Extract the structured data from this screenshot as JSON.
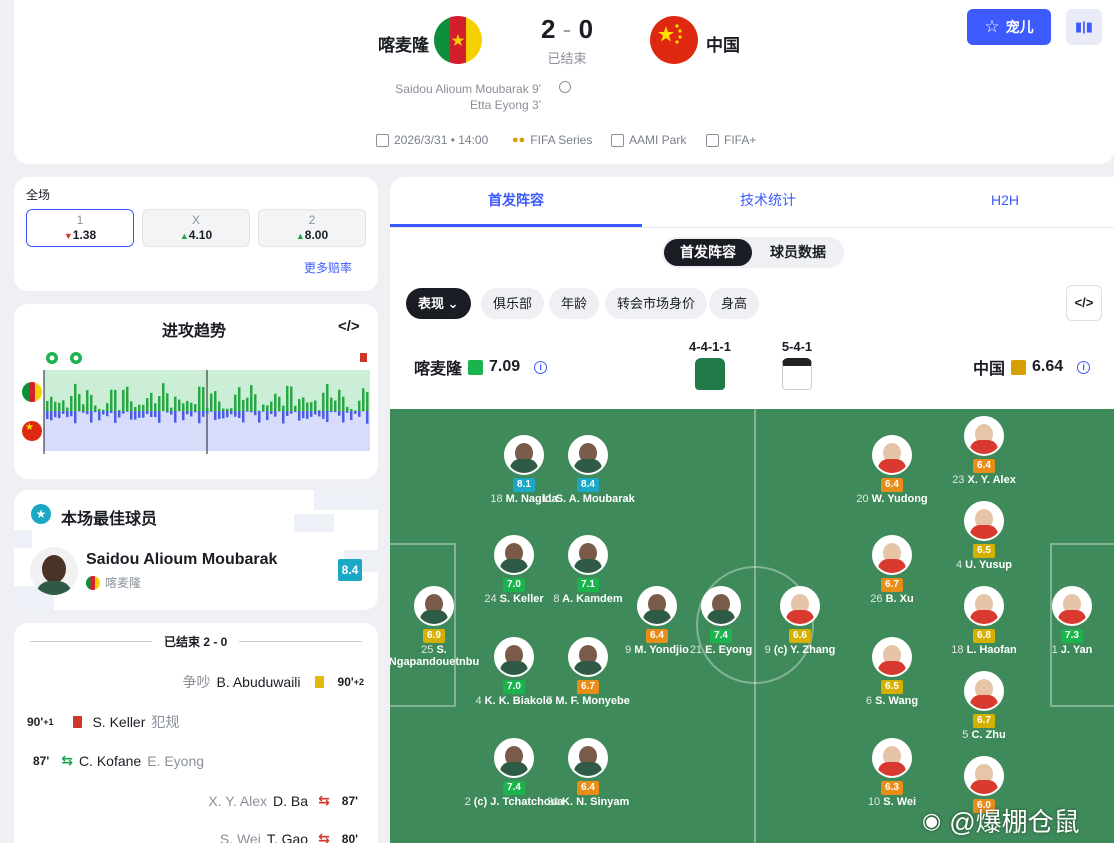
{
  "match": {
    "home_team": "喀麦隆",
    "away_team": "中国",
    "score_home": "2",
    "score_sep": "-",
    "score_away": "0",
    "status": "已结束",
    "scorers": [
      "Saidou Alioum Moubarak 9'",
      "Etta Eyong 3'"
    ],
    "date": "2026/3/31 • 14:00",
    "competition": "FIFA Series",
    "venue": "AAMI Park",
    "broadcast": "FIFA+",
    "follow_label": "宠儿"
  },
  "odds": {
    "title": "全场",
    "items": [
      {
        "label": "1",
        "value": "1.38",
        "trend": "down"
      },
      {
        "label": "X",
        "value": "4.10",
        "trend": "up"
      },
      {
        "label": "2",
        "value": "8.00",
        "trend": "up"
      }
    ],
    "more_label": "更多赔率"
  },
  "momentum": {
    "title": "进攻趋势",
    "embed": "</>"
  },
  "best_player": {
    "title": "本场最佳球员",
    "name": "Saidou Alioum Moubarak",
    "team": "喀麦隆",
    "rating": "8.4"
  },
  "events": {
    "header": "已结束 2 - 0",
    "items": [
      {
        "side": "right",
        "minute": "90'",
        "extra": "+2",
        "type": "yellow",
        "player": "B. Abuduwaili",
        "note": "争吵"
      },
      {
        "side": "left",
        "minute": "90'",
        "extra": "+1",
        "type": "red",
        "player": "S. Keller",
        "note": "犯规"
      },
      {
        "side": "left",
        "minute": "87'",
        "extra": "",
        "type": "sub",
        "player": "C. Kofane",
        "note": "E. Eyong"
      },
      {
        "side": "right",
        "minute": "87'",
        "extra": "",
        "type": "sub",
        "player": "D. Ba",
        "note": "X. Y. Alex"
      },
      {
        "side": "right",
        "minute": "80'",
        "extra": "",
        "type": "sub",
        "player": "T. Gao",
        "note": "S. Wei"
      }
    ]
  },
  "lineup": {
    "tabs": [
      "首发阵容",
      "技术统计",
      "H2H"
    ],
    "segments": [
      "首发阵容",
      "球员数据"
    ],
    "filters": [
      "表现",
      "俱乐部",
      "年龄",
      "转会市场身价",
      "身高"
    ],
    "home": {
      "name": "喀麦隆",
      "rating": "7.09",
      "formation": "4-4-1-1",
      "color": "#1bb34d"
    },
    "away": {
      "name": "中国",
      "rating": "6.64",
      "formation": "5-4-1",
      "color": "#d6a000"
    },
    "home_players": [
      {
        "no": "25",
        "name": "S. Ngapandouetnbu",
        "rating": "6.9",
        "c": "y"
      },
      {
        "no": "24",
        "name": "S. Keller",
        "rating": "7.0",
        "c": "g"
      },
      {
        "no": "4",
        "name": "K. K. Biakolo",
        "rating": "7.0",
        "c": "g"
      },
      {
        "no": "2",
        "name": "(c) J. Tchatchoua",
        "rating": "7.4",
        "c": "g"
      },
      {
        "no": "18",
        "name": "M. Nagida",
        "rating": "8.1",
        "c": "c"
      },
      {
        "no": "8",
        "name": "A. Kamdem",
        "rating": "7.1",
        "c": "g"
      },
      {
        "no": "7",
        "name": "M. F. Monyebe",
        "rating": "6.7",
        "c": "o"
      },
      {
        "no": "20",
        "name": "K. N. Sinyam",
        "rating": "6.4",
        "c": "o"
      },
      {
        "no": "11",
        "name": "S. A. Moubarak",
        "rating": "8.4",
        "c": "c"
      },
      {
        "no": "9",
        "name": "M. Yondjio",
        "rating": "6.4",
        "c": "o"
      },
      {
        "no": "21",
        "name": "E. Eyong",
        "rating": "7.4",
        "c": "g"
      }
    ],
    "away_players": [
      {
        "no": "9",
        "name": "(c) Y. Zhang",
        "rating": "6.6",
        "c": "y"
      },
      {
        "no": "20",
        "name": "W. Yudong",
        "rating": "6.4",
        "c": "o"
      },
      {
        "no": "26",
        "name": "B. Xu",
        "rating": "6.7",
        "c": "o"
      },
      {
        "no": "6",
        "name": "S. Wang",
        "rating": "6.5",
        "c": "y"
      },
      {
        "no": "10",
        "name": "S. Wei",
        "rating": "6.3",
        "c": "o"
      },
      {
        "no": "23",
        "name": "X. Y. Alex",
        "rating": "6.4",
        "c": "o"
      },
      {
        "no": "4",
        "name": "U. Yusup",
        "rating": "6.5",
        "c": "y"
      },
      {
        "no": "18",
        "name": "L. Haofan",
        "rating": "6.8",
        "c": "y"
      },
      {
        "no": "5",
        "name": "C. Zhu",
        "rating": "6.7",
        "c": "y"
      },
      {
        "no": "",
        "name": "",
        "rating": "6.0",
        "c": "o"
      },
      {
        "no": "1",
        "name": "J. Yan",
        "rating": "7.3",
        "c": "g"
      }
    ]
  },
  "watermark": "@爆棚仓鼠"
}
